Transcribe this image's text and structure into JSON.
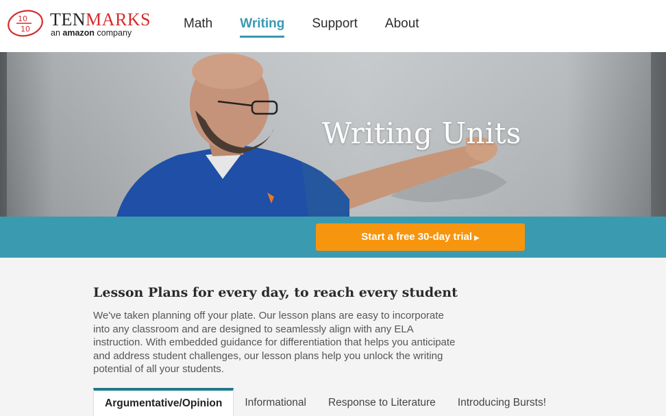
{
  "brand": {
    "name_part1": "TEN",
    "name_part2": "MARKS",
    "tagline_prefix": "an",
    "tagline_brand": "amazon",
    "tagline_suffix": "company",
    "logo_text": "10/10",
    "accent_red": "#d52b2b"
  },
  "nav": {
    "items": [
      {
        "label": "Math",
        "active": false
      },
      {
        "label": "Writing",
        "active": true
      },
      {
        "label": "Support",
        "active": false
      },
      {
        "label": "About",
        "active": false
      }
    ],
    "active_color": "#3a98b0"
  },
  "hero": {
    "title": "Writing Units"
  },
  "cta": {
    "label": "Start a free 30-day trial",
    "arrow_icon": "play-arrow-icon",
    "button_color": "#f7950f",
    "band_color": "#3a9bb0"
  },
  "section": {
    "title": "Lesson Plans for every day, to reach every student",
    "body": "We've taken planning off your plate. Our lesson plans are easy to incorporate into any classroom and are designed to seamlessly align with any ELA instruction. With embedded guidance for differentiation that helps you anticipate and address student challenges, our lesson plans help you unlock the writing potential of all your students."
  },
  "tabs": [
    {
      "label": "Argumentative/Opinion",
      "active": true
    },
    {
      "label": "Informational",
      "active": false
    },
    {
      "label": "Response to Literature",
      "active": false
    },
    {
      "label": "Introducing Bursts!",
      "active": false
    }
  ]
}
